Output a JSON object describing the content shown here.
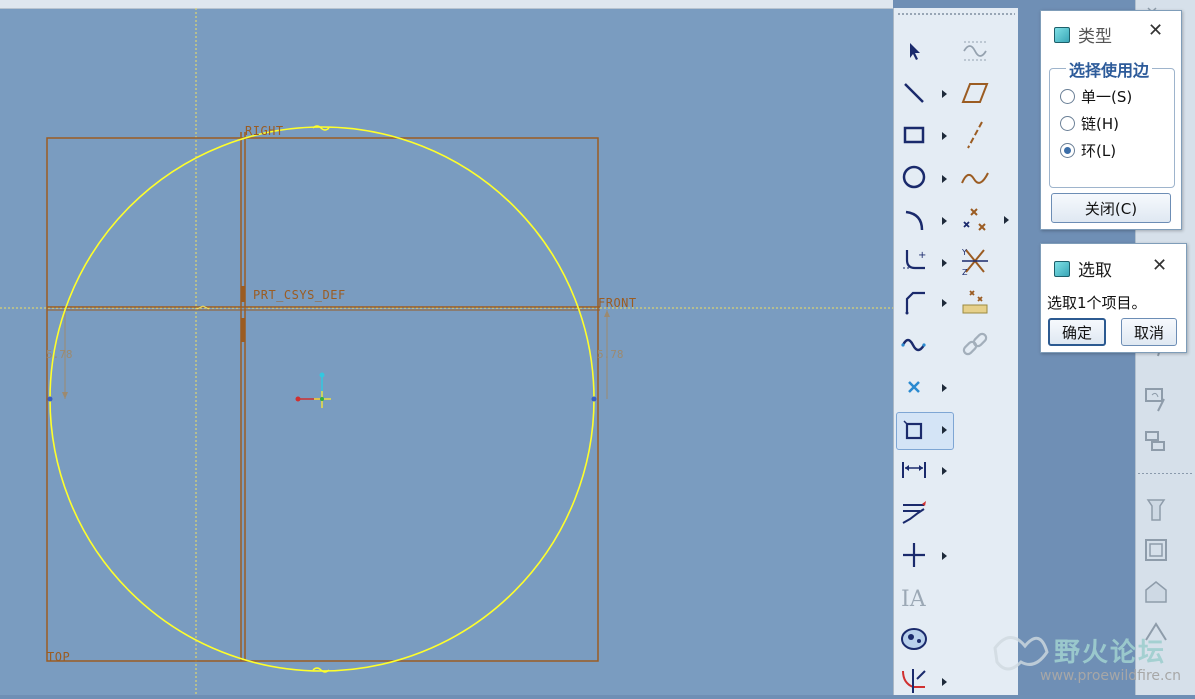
{
  "sketch": {
    "labels": {
      "right": "RIGHT",
      "front": "FRONT",
      "top": "TOP",
      "csys": "PRT_CSYS_DEF",
      "dim_left": "5.78",
      "dim_right": "5.78"
    }
  },
  "sketch_toolbar": {
    "icons": [
      "select-arrow-icon",
      "line-icon",
      "rectangle-icon",
      "circle-icon",
      "arc-icon",
      "fillet-icon",
      "chamfer-icon",
      "spline-icon",
      "point-icon",
      "use-edge-icon",
      "dimension-icon",
      "modify-icon",
      "constraint-icon",
      "text-icon",
      "palette-icon",
      "trim-icon"
    ],
    "secondary_icons": [
      "inspect-icon",
      "parallelogram-icon",
      "centerline-icon",
      "curve-icon",
      "points-icon",
      "intersect-icon",
      "measure-icon",
      "chain-link-icon"
    ]
  },
  "type_dialog": {
    "title": "类型",
    "group_label": "选择使用边",
    "options": [
      {
        "label": "单一(S)",
        "selected": false
      },
      {
        "label": "链(H)",
        "selected": false
      },
      {
        "label": "环(L)",
        "selected": true
      }
    ],
    "close_button": "关闭(C)"
  },
  "select_dialog": {
    "title": "选取",
    "message": "选取1个项目。",
    "ok_button": "确定",
    "cancel_button": "取消"
  },
  "watermark": {
    "name": "野火论坛",
    "url": "www.proewildfire.cn"
  },
  "colors": {
    "canvas": "#7a9cc0",
    "reference_line": "#9b5c22",
    "circle": "#ffff2a",
    "axis_dotted": "#f0e060"
  }
}
